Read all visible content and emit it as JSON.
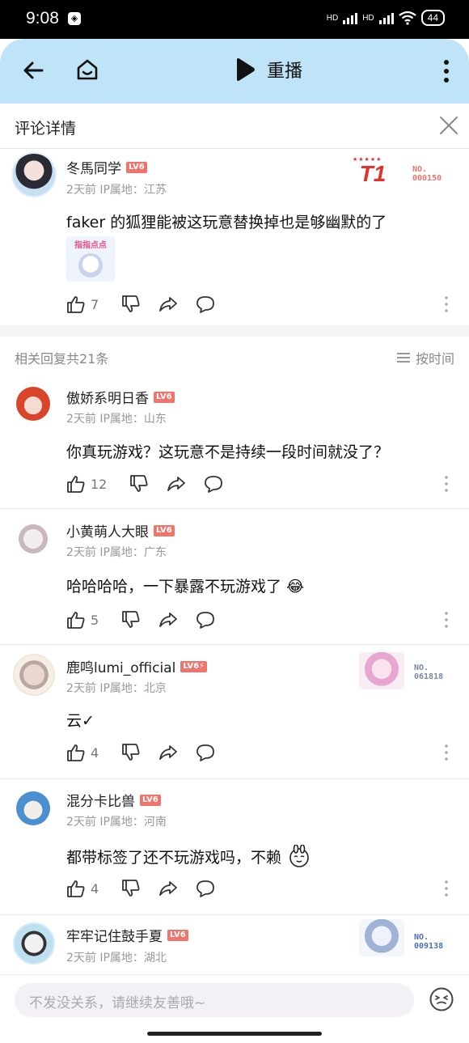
{
  "status": {
    "time": "9:08",
    "hd1": "HD",
    "hd2": "HD",
    "battery": "44"
  },
  "topbar": {
    "replay_label": "重播"
  },
  "header": {
    "title": "评论详情"
  },
  "main_comment": {
    "name": "冬馬同学",
    "level": "LV6",
    "meta": "2天前 IP属地：江苏",
    "text": "faker 的狐狸能被这玩意替换掉也是够幽默的了",
    "sticker_text": "指指点点",
    "likes": "7",
    "badge_no": "NO.",
    "badge_num": "000150",
    "badge_logo": "T1"
  },
  "replies_header": {
    "count_label": "相关回复共21条",
    "sort_label": "按时间"
  },
  "replies": [
    {
      "name": "傲娇系明日香",
      "level": "LV6",
      "meta": "2天前 IP属地：山东",
      "text": "你真玩游戏？这玩意不是持续一段时间就没了？",
      "likes": "12"
    },
    {
      "name": "小黄萌人大眼",
      "level": "LV6",
      "meta": "2天前 IP属地：广东",
      "text": "哈哈哈哈，一下暴露不玩游戏了 😂",
      "likes": "5"
    },
    {
      "name": "鹿鸣lumi_official",
      "level": "LV6⚡",
      "meta": "2天前 IP属地：北京",
      "text": "云✓",
      "likes": "4",
      "badge_no": "NO.",
      "badge_num": "061818"
    },
    {
      "name": "混分卡比兽",
      "level": "LV6",
      "meta": "2天前 IP属地：河南",
      "text": "都带标签了还不玩游戏吗，不赖",
      "likes": "4"
    },
    {
      "name": "牢牢记住鼓手夏",
      "level": "LV6",
      "meta": "2天前 IP属地：湖北",
      "badge_no": "NO.",
      "badge_num": "009138"
    }
  ],
  "bottom": {
    "placeholder": "不发没关系，请继续友善哦~"
  },
  "colors": {
    "accent": "#bfe3f7",
    "level_badge": "#f0746b",
    "meta": "#999999"
  }
}
